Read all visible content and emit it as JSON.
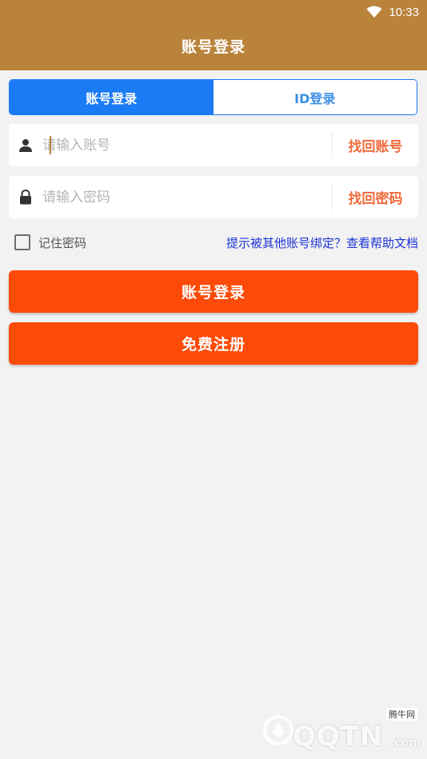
{
  "status_bar": {
    "time": "10:33"
  },
  "header": {
    "title": "账号登录"
  },
  "tabs": [
    {
      "label": "账号登录",
      "active": true
    },
    {
      "label": "ID登录",
      "active": false
    }
  ],
  "account_field": {
    "placeholder": "请输入账号",
    "value": "",
    "link": "找回账号",
    "icon": "user-icon"
  },
  "password_field": {
    "placeholder": "请输入密码",
    "value": "",
    "link": "找回密码",
    "icon": "lock-icon"
  },
  "options": {
    "remember_label": "记住密码",
    "remember_checked": false,
    "help_link": "提示被其他账号绑定？查看帮助文档"
  },
  "buttons": {
    "login": "账号登录",
    "register": "免费注册"
  },
  "watermark": {
    "brand": "QQTN",
    "site": "腾牛网",
    "suffix": ".com"
  },
  "colors": {
    "header": "#b9833b",
    "tab_active": "#1b7bf5",
    "link_orange": "#f06a3a",
    "primary_button": "#fc4a08",
    "help_link": "#1a32d8",
    "background": "#f2f2f2"
  }
}
